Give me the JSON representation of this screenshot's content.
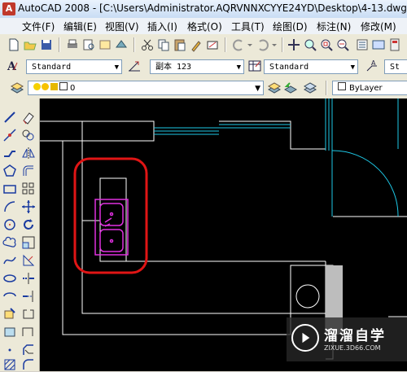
{
  "window": {
    "title": "AutoCAD 2008 - [C:\\Users\\Administrator.AQRVNNXCYYE24YD\\Desktop\\4-13.dwg]",
    "app_icon_letter": "A"
  },
  "menu": {
    "items": [
      "文件(F)",
      "编辑(E)",
      "视图(V)",
      "插入(I)",
      "格式(O)",
      "工具(T)",
      "绘图(D)",
      "标注(N)",
      "修改(M)"
    ]
  },
  "styles_toolbar": {
    "text_style": "Standard",
    "dim_style": "副本 123",
    "table_style": "Standard",
    "multileader_style": "St"
  },
  "layers_toolbar": {
    "current_layer": "0"
  },
  "properties_toolbar": {
    "color": "ByLayer"
  },
  "icons": {
    "standard": [
      "new-icon",
      "open-icon",
      "save-icon",
      "print-icon",
      "plot-preview-icon",
      "publish-icon",
      "3d-dwf-icon",
      "cut-icon",
      "copy-icon",
      "paste-icon",
      "match-properties-icon",
      "block-editor-icon",
      "undo-icon",
      "redo-icon",
      "pan-icon",
      "zoom-realtime-icon",
      "zoom-window-icon",
      "zoom-previous-icon"
    ],
    "draw": [
      "line-icon",
      "construction-line-icon",
      "polyline-icon",
      "polygon-icon",
      "rectangle-icon",
      "arc-icon",
      "circle-icon",
      "revision-cloud-icon",
      "spline-icon",
      "ellipse-icon",
      "ellipse-arc-icon",
      "insert-block-icon",
      "make-block-icon",
      "point-icon",
      "hatch-icon"
    ],
    "modify": [
      "erase-icon",
      "copy-object-icon",
      "mirror-icon",
      "offset-icon",
      "array-icon",
      "move-icon",
      "rotate-icon",
      "scale-icon",
      "stretch-icon",
      "trim-icon",
      "extend-icon",
      "break-icon",
      "join-icon",
      "chamfer-icon",
      "fillet-icon"
    ]
  },
  "colors": {
    "canvas": "#000000",
    "lines": "#ffffff",
    "window_lines": "#1ec8e6",
    "sink": "#e030e0",
    "highlight": "#e01515"
  },
  "watermark": {
    "title": "溜溜自学",
    "subtitle": "ZIXUE.3D66.COM"
  }
}
